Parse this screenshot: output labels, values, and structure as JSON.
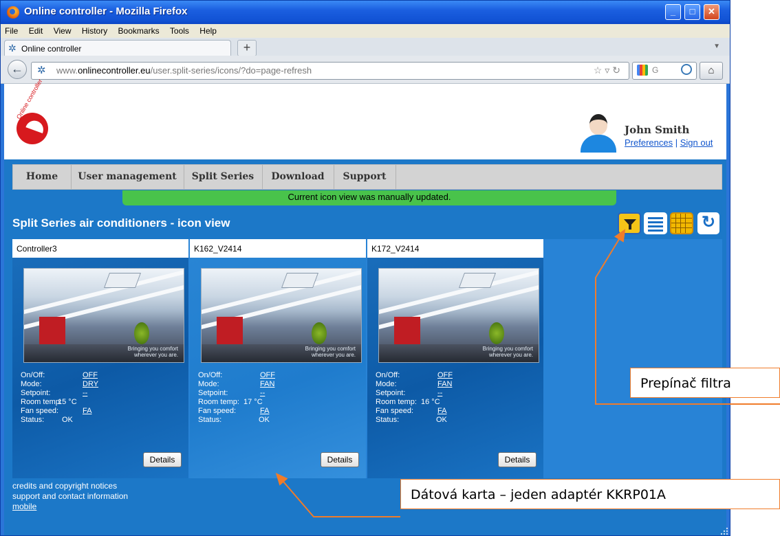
{
  "window": {
    "title": "Online controller - Mozilla Firefox",
    "min_glyph": "_",
    "max_glyph": "□",
    "close_glyph": "✕"
  },
  "menu": [
    "File",
    "Edit",
    "View",
    "History",
    "Bookmarks",
    "Tools",
    "Help"
  ],
  "tab": {
    "icon": "gear-favicon",
    "label": "Online controller",
    "new_tab_glyph": "+"
  },
  "address": {
    "prefix": "www.",
    "host": "onlinecontroller.eu",
    "path": "/user.split-series/icons/?do=page-refresh",
    "search_placeholder": "G"
  },
  "header": {
    "logo_text": "Online controller",
    "user_name": "John Smith",
    "preferences_link": "Preferences",
    "separator": " | ",
    "signout_link": "Sign out"
  },
  "nav": [
    "Home",
    "User management",
    "Split Series",
    "Download",
    "Support"
  ],
  "notice": "Current icon view was manually updated.",
  "page_title": "Split Series air conditioners - icon view",
  "toolbar": {
    "filter_icon": "filter-icon",
    "list_icon": "list-view-icon",
    "grid_icon": "grid-view-icon",
    "refresh_icon": "refresh-icon"
  },
  "labels": {
    "on_off": "On/Off:",
    "mode": "Mode:",
    "setpoint": "Setpoint:",
    "room_temp": "Room temp:",
    "fan_speed": "Fan speed:",
    "status": "Status:",
    "details": "Details"
  },
  "photo_watermark": [
    "Bringing you comfort",
    "wherever you are."
  ],
  "cards": [
    {
      "name": "Controller3",
      "on_off": "OFF",
      "mode": "DRY",
      "setpoint": "--",
      "room_temp": "15 °C",
      "fan_speed": "FA",
      "status": "OK"
    },
    {
      "name": "K162_V2414",
      "on_off": "OFF",
      "mode": "FAN",
      "setpoint": "--",
      "room_temp": "17 °C",
      "fan_speed": "FA",
      "status": "OK"
    },
    {
      "name": "K172_V2414",
      "on_off": "OFF",
      "mode": "FAN",
      "setpoint": "--",
      "room_temp": "16 °C",
      "fan_speed": "FA",
      "status": "OK"
    }
  ],
  "footer": [
    "credits and copyright notices",
    "support and contact information",
    "mobile"
  ],
  "annotations": {
    "filter_callout": "Prepínač filtra",
    "card_callout": "Dátová karta – jeden adaptér KKRP01A"
  },
  "colors": {
    "accent_orange": "#f07c2a",
    "notice_green": "#49c34b",
    "page_blue": "#1c78c8",
    "filter_yellow": "#f5c518"
  }
}
